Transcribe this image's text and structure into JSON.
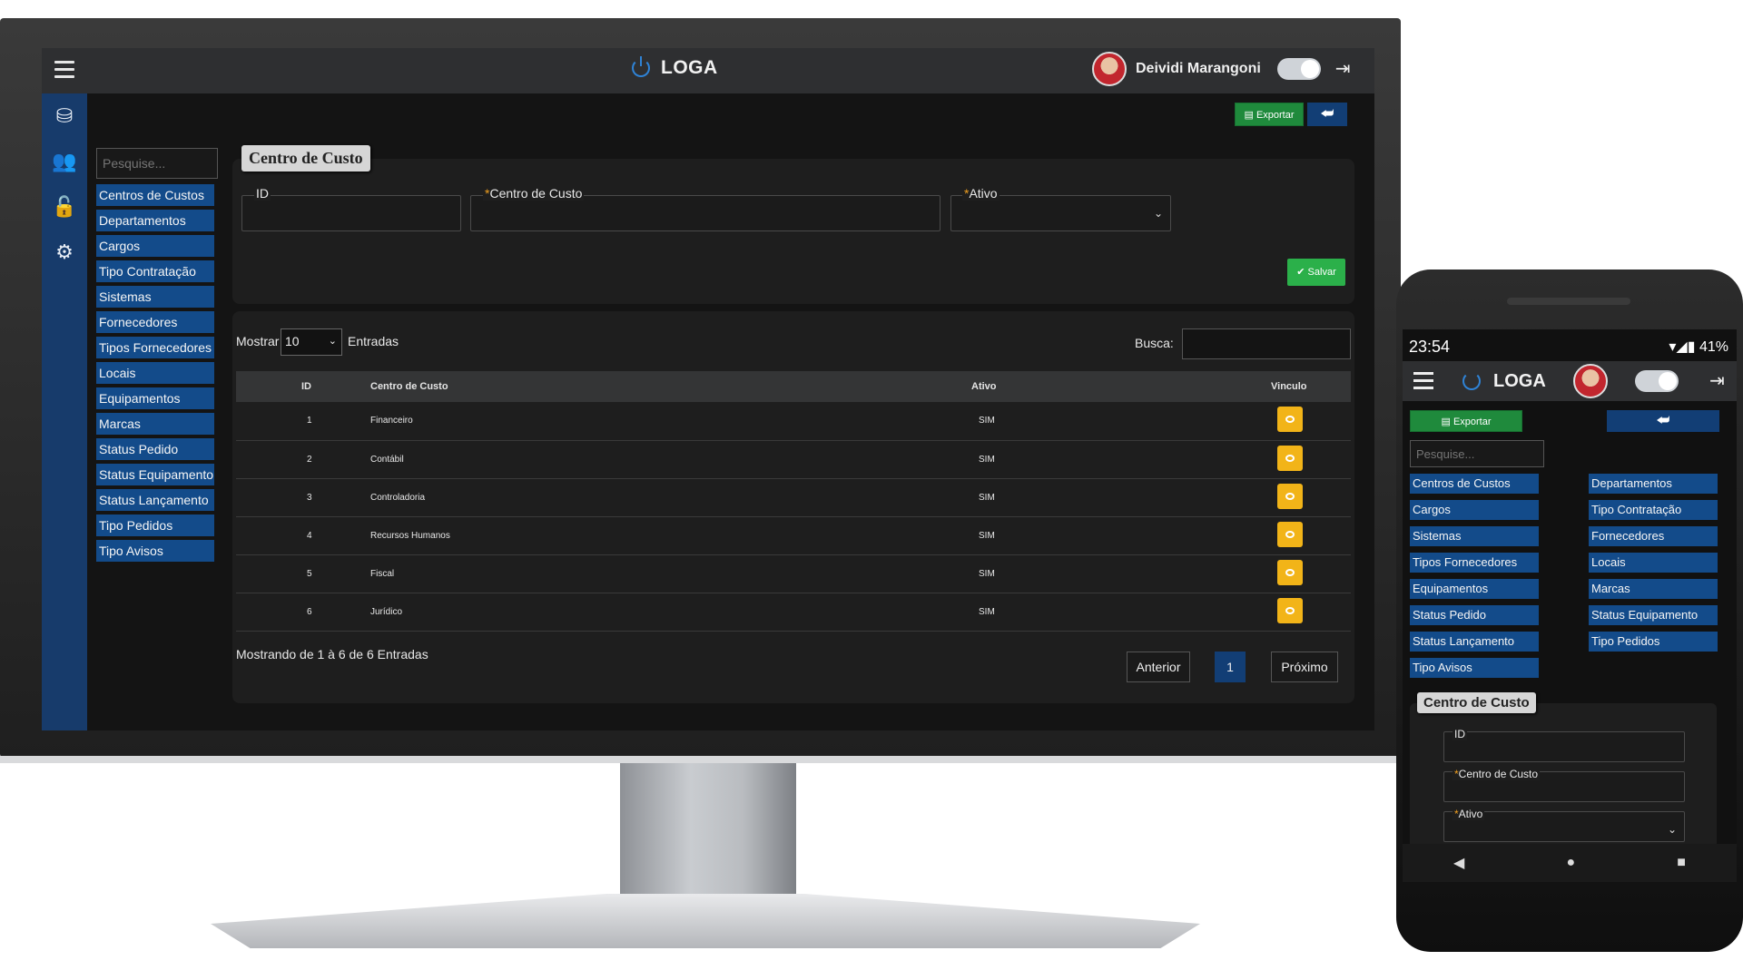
{
  "app": {
    "title": "LOGA",
    "user_name": "Deividi Marangoni"
  },
  "icons": {
    "menu": "hamburger-icon",
    "power": "power-icon",
    "logout": "logout-icon",
    "theme": "theme-toggle",
    "rail": [
      "database-icon",
      "users-icon",
      "lock-icon",
      "gear-icon"
    ],
    "back": "back-arrow-icon",
    "view": "eye-icon",
    "save": "check-icon",
    "export": "spreadsheet-icon"
  },
  "colors": {
    "primary": "#134b8a",
    "success": "#2bb04a",
    "export": "#1f8a3c",
    "warning": "#f2b418",
    "accent": "#2f83d6"
  },
  "search": {
    "placeholder": "Pesquise..."
  },
  "menu": [
    "Centros de Custos",
    "Departamentos",
    "Cargos",
    "Tipo Contratação",
    "Sistemas",
    "Fornecedores",
    "Tipos Fornecedores",
    "Locais",
    "Equipamentos",
    "Marcas",
    "Status Pedido",
    "Status Equipamento",
    "Status Lançamento",
    "Tipo Pedidos",
    "Tipo Avisos"
  ],
  "toolbar": {
    "export_label": "Exportar"
  },
  "form": {
    "title": "Centro de Custo",
    "id_label": "ID",
    "centro_label": "Centro de Custo",
    "ativo_label": "Ativo",
    "required_mark": "*",
    "save_label": "Salvar"
  },
  "table": {
    "show_label": "Mostrar",
    "show_value": "10",
    "entries_label": "Entradas",
    "search_label": "Busca:",
    "columns": [
      "ID",
      "Centro de Custo",
      "Ativo",
      "Vinculo"
    ],
    "rows": [
      {
        "id": "1",
        "nome": "Financeiro",
        "ativo": "SIM"
      },
      {
        "id": "2",
        "nome": "Contábil",
        "ativo": "SIM"
      },
      {
        "id": "3",
        "nome": "Controladoria",
        "ativo": "SIM"
      },
      {
        "id": "4",
        "nome": "Recursos Humanos",
        "ativo": "SIM"
      },
      {
        "id": "5",
        "nome": "Fiscal",
        "ativo": "SIM"
      },
      {
        "id": "6",
        "nome": "Jurídico",
        "ativo": "SIM"
      }
    ],
    "footer": "Mostrando de 1 à 6 de 6 Entradas",
    "prev": "Anterior",
    "page": "1",
    "next": "Próximo"
  },
  "phone": {
    "time": "23:54",
    "battery": "41%"
  }
}
